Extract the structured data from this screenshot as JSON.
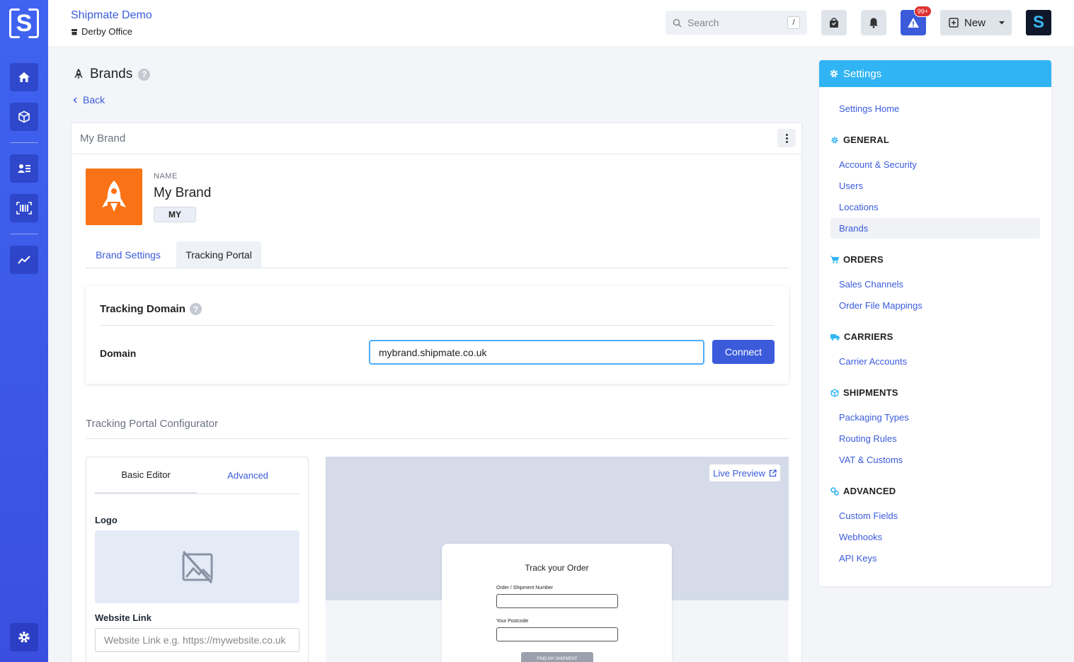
{
  "app": {
    "logo_letter": "S",
    "company_name": "Shipmate Demo",
    "office_name": "Derby Office"
  },
  "rail": {
    "items": [
      "home-icon",
      "box-icon",
      "contacts-icon",
      "barcode-icon",
      "chart-icon",
      "gear-icon"
    ]
  },
  "topbar": {
    "search_placeholder": "Search",
    "search_shortcut": "/",
    "alerts_badge": "99+",
    "new_label": "New",
    "avatar_letter": "S"
  },
  "page": {
    "title": "Brands",
    "back_label": "Back"
  },
  "brand_card": {
    "header": "My Brand",
    "name_label": "NAME",
    "name_value": "My Brand",
    "code": "MY",
    "tabs": [
      "Brand Settings",
      "Tracking Portal"
    ]
  },
  "tracking_domain": {
    "title": "Tracking Domain",
    "domain_label": "Domain",
    "domain_value": "mybrand.shipmate.co.uk",
    "connect_label": "Connect"
  },
  "configurator": {
    "title": "Tracking Portal Configurator",
    "editor_tabs": [
      "Basic Editor",
      "Advanced"
    ],
    "logo_label": "Logo",
    "website_label": "Website Link",
    "website_placeholder": "Website Link e.g. https://mywebsite.co.uk",
    "live_preview_label": "Live Preview",
    "preview": {
      "title": "Track your Order",
      "field1_label": "Order / Shipment Number",
      "field2_label": "Your Postcode",
      "button_label": "FIND MY SHIPMENT"
    }
  },
  "settings": {
    "title": "Settings",
    "home_link": "Settings Home",
    "sections": [
      {
        "name": "GENERAL",
        "icon": "gear-icon",
        "items": [
          "Account & Security",
          "Users",
          "Locations",
          "Brands"
        ]
      },
      {
        "name": "ORDERS",
        "icon": "cart-icon",
        "items": [
          "Sales Channels",
          "Order File Mappings"
        ]
      },
      {
        "name": "CARRIERS",
        "icon": "truck-icon",
        "items": [
          "Carrier Accounts"
        ]
      },
      {
        "name": "SHIPMENTS",
        "icon": "box-icon",
        "items": [
          "Packaging Types",
          "Routing Rules",
          "VAT & Customs"
        ]
      },
      {
        "name": "ADVANCED",
        "icon": "cogs-icon",
        "items": [
          "Custom Fields",
          "Webhooks",
          "API Keys"
        ]
      }
    ],
    "active_item": "Brands"
  },
  "colors": {
    "primary": "#3b5bdb",
    "rail": "#3f63f0",
    "settings_header": "#31b4f4",
    "brand_logo_bg": "#f97316"
  }
}
